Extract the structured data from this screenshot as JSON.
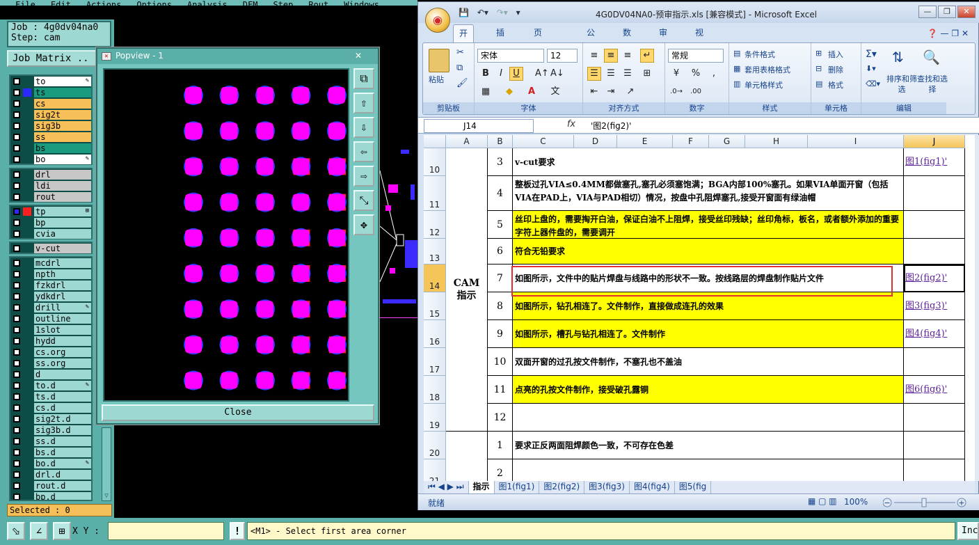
{
  "cam": {
    "menu": [
      "File",
      "Edit",
      "Actions",
      "Options",
      "Analysis",
      "DFM",
      "Step",
      "Rout",
      "Windows"
    ],
    "job_line": "Job : 4g0dv04na0",
    "step_line": "Step: cam",
    "job_matrix_label": "Job Matrix ..",
    "layers_group1": [
      {
        "name": "to",
        "color": "#ffffff",
        "swatch": "",
        "icon": "✎"
      },
      {
        "name": "ts",
        "color": "#1a9a7e",
        "swatch": "#2a2aff",
        "icon": ""
      },
      {
        "name": "cs",
        "color": "#f6bf57",
        "swatch": "",
        "icon": ""
      },
      {
        "name": "sig2t",
        "color": "#f6bf57",
        "swatch": "",
        "icon": ""
      },
      {
        "name": "sig3b",
        "color": "#f6bf57",
        "swatch": "",
        "icon": ""
      },
      {
        "name": "ss",
        "color": "#f6bf57",
        "swatch": "",
        "icon": ""
      },
      {
        "name": "bs",
        "color": "#1a9a7e",
        "swatch": "",
        "icon": ""
      },
      {
        "name": "bo",
        "color": "#ffffff",
        "swatch": "",
        "icon": "✎"
      }
    ],
    "layers_group2": [
      {
        "name": "drl",
        "color": "#c7c7c7"
      },
      {
        "name": "ldi",
        "color": "#c7c7c7"
      },
      {
        "name": "rout",
        "color": "#c7c7c7"
      }
    ],
    "layers_group3": [
      {
        "name": "tp",
        "color": "#9ed8d2",
        "swatch": "#ff2020",
        "checked": true,
        "icon": "⊞"
      },
      {
        "name": "bp",
        "color": "#9ed8d2"
      },
      {
        "name": "cvia",
        "color": "#9ed8d2"
      }
    ],
    "layers_group4": [
      {
        "name": "v-cut",
        "color": "#c7c7c7"
      }
    ],
    "layers_group5": [
      {
        "name": "mcdrl",
        "icon": ""
      },
      {
        "name": "npth",
        "icon": ""
      },
      {
        "name": "fzkdrl",
        "icon": ""
      },
      {
        "name": "ydkdrl",
        "icon": ""
      },
      {
        "name": "drill",
        "icon": "✎"
      },
      {
        "name": "outline",
        "icon": ""
      },
      {
        "name": "1slot",
        "icon": ""
      },
      {
        "name": "hydd",
        "icon": ""
      },
      {
        "name": "cs.org",
        "icon": ""
      },
      {
        "name": "ss.org",
        "icon": ""
      },
      {
        "name": "d",
        "icon": ""
      },
      {
        "name": "to.d",
        "icon": "✎"
      },
      {
        "name": "ts.d",
        "icon": ""
      },
      {
        "name": "cs.d",
        "icon": ""
      },
      {
        "name": "sig2t.d",
        "icon": ""
      },
      {
        "name": "sig3b.d",
        "icon": ""
      },
      {
        "name": "ss.d",
        "icon": ""
      },
      {
        "name": "bs.d",
        "icon": ""
      },
      {
        "name": "bo.d",
        "icon": "✎"
      },
      {
        "name": "drl.d",
        "icon": ""
      },
      {
        "name": "rout.d",
        "icon": ""
      },
      {
        "name": "bp.d",
        "icon": ""
      }
    ],
    "selected_label": "Selected : 0",
    "xy_label": "X Y :",
    "xy_value": "",
    "prompt": "<M1> - Select first area corner",
    "inc_label": "Inc",
    "warn_glyph": "!"
  },
  "popview": {
    "title": "Popview - 1",
    "close_label": "Close",
    "pad_grid": {
      "rows": 9,
      "cols": 5,
      "pad_color": "#ff00ff",
      "outline_color": "#2a3cff",
      "red_color": "#ff2020",
      "red_square_cols": [
        3,
        4
      ],
      "red_square_rows_col3": [
        2,
        4,
        5,
        6,
        7,
        8
      ],
      "red_square_rows_col4": [
        2,
        3,
        4,
        5,
        6,
        7,
        8
      ]
    }
  },
  "excel": {
    "title": "4G0DV04NA0-预审指示.xls [兼容模式] - Microsoft Excel",
    "tabs": [
      "开始",
      "插入",
      "页面布局",
      "公式",
      "数据",
      "审阅",
      "视图"
    ],
    "font_name": "宋体",
    "font_size": "12",
    "number_format": "常规",
    "group_labels": [
      "剪贴板",
      "字体",
      "对齐方式",
      "数字",
      "样式",
      "单元格",
      "编辑"
    ],
    "paste_label": "粘贴",
    "styles_items": [
      "条件格式",
      "套用表格格式",
      "单元格样式"
    ],
    "cells_items": [
      "插入",
      "删除",
      "格式"
    ],
    "edit_items": [
      "排序和筛选",
      "查找和选择"
    ],
    "name_box": "J14",
    "formula": "'图2(fig2)'",
    "columns": [
      "A",
      "B",
      "C",
      "D",
      "E",
      "F",
      "G",
      "H",
      "I",
      "J"
    ],
    "merged_a_label": "CAM\n指示",
    "rows": [
      {
        "row": "10",
        "num": "3",
        "text": "v-cut要求",
        "yellow": false,
        "link": "图1(fig1)'"
      },
      {
        "row": "11",
        "num": "4",
        "text": "整板过孔VIA≤0.4MM都做塞孔,塞孔必须塞饱满；BGA内部100%塞孔。如果VIA单面开窗（包括VIA在PAD上，VIA与PAD相切）情况，按盘中孔阻焊塞孔,接受开窗面有绿油帽",
        "yellow": false,
        "link": ""
      },
      {
        "row": "12",
        "num": "5",
        "text": "丝印上盘的，需要掏开白油，保证白油不上阻焊，接受丝印残缺；丝印角标，板名，或者额外添加的重要字符上器件盘的，需要调开",
        "yellow": true,
        "link": ""
      },
      {
        "row": "13",
        "num": "6",
        "text": "符合无铅要求",
        "yellow": true,
        "link": ""
      },
      {
        "row": "14",
        "num": "7",
        "text": "如图所示，文件中的贴片焊盘与线路中的形状不一致。按线路层的焊盘制作贴片文件",
        "yellow": false,
        "link": "图2(fig2)'"
      },
      {
        "row": "15",
        "num": "8",
        "text": "如图所示，钻孔相连了。文件制作，直接做成连孔的效果",
        "yellow": true,
        "link": "图3(fig3)'"
      },
      {
        "row": "16",
        "num": "9",
        "text": "如图所示，槽孔与钻孔相连了。文件制作",
        "yellow": true,
        "link": "图4(fig4)'"
      },
      {
        "row": "17",
        "num": "10",
        "text": "双面开窗的过孔按文件制作，不塞孔也不盖油",
        "yellow": false,
        "link": ""
      },
      {
        "row": "18",
        "num": "11",
        "text": "点亮的孔按文件制作，接受破孔露铜",
        "yellow": true,
        "link": "图6(fig6)'"
      },
      {
        "row": "19",
        "num": "12",
        "text": "",
        "yellow": false,
        "link": ""
      },
      {
        "row": "20",
        "num": "1",
        "text": "要求正反两面阻焊颜色一致，不可存在色差",
        "yellow": false,
        "link": ""
      },
      {
        "row": "21",
        "num": "2",
        "text": "",
        "yellow": false,
        "link": ""
      }
    ],
    "sheet_tabs": [
      "指示",
      "图1(fig1)",
      "图2(fig2)",
      "图3(fig3)",
      "图4(fig4)",
      "图5(fig"
    ],
    "status_ready": "就绪",
    "zoom": "100%"
  }
}
